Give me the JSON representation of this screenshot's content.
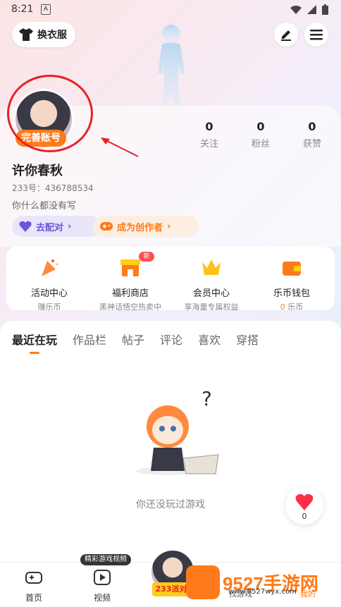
{
  "status_bar": {
    "time": "8:21",
    "sim_label": "A"
  },
  "header": {
    "wardrobe_label": "换衣服"
  },
  "profile": {
    "complete_badge": "完善账号",
    "username": "许你春秋",
    "uid": "233号：436788534",
    "bio": "你什么都没有写",
    "stats": [
      {
        "value": "0",
        "label": "关注"
      },
      {
        "value": "0",
        "label": "粉丝"
      },
      {
        "value": "0",
        "label": "获赞"
      }
    ],
    "pair_label": "去配对",
    "creator_label": "成为创作者"
  },
  "features": [
    {
      "title": "活动中心",
      "subtitle": "赚乐币",
      "icon": "party-popper-icon"
    },
    {
      "title": "福利商店",
      "subtitle": "黑神话悟空热卖中",
      "icon": "shop-icon"
    },
    {
      "title": "会员中心",
      "subtitle": "享海量专属权益",
      "icon": "crown-icon"
    },
    {
      "title": "乐币钱包",
      "subtitle_value": "0",
      "subtitle_unit": " 乐币",
      "icon": "wallet-icon"
    }
  ],
  "new_badge": "新",
  "tabs": [
    "最近在玩",
    "作品栏",
    "帖子",
    "评论",
    "喜欢",
    "穿搭"
  ],
  "empty_state": "你还没玩过游戏",
  "heart_count": "0",
  "bottom_nav": {
    "home": "首页",
    "video": "视频",
    "video_tooltip": "精彩游戏视频",
    "center_label": "233派对",
    "find": "找游戏",
    "mine": "我的"
  },
  "watermark": {
    "brand": "9527手游网",
    "url": "www.9527wyx.com"
  },
  "colors": {
    "accent": "#ff7a1a",
    "purple": "#6b55d9",
    "red": "#e52229"
  }
}
